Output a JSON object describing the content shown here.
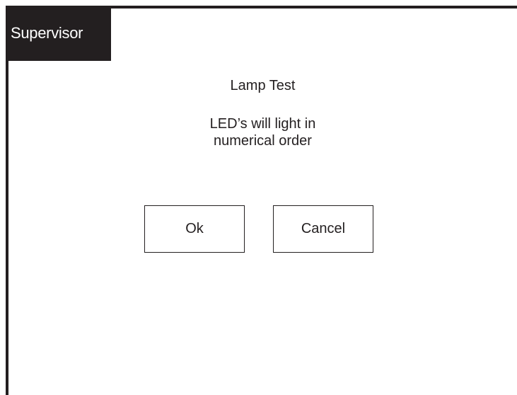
{
  "header": {
    "tab_label": "Supervisor"
  },
  "dialog": {
    "title": "Lamp Test",
    "message_line1": "LED’s will light in",
    "message_line2": "numerical order",
    "ok_label": "Ok",
    "cancel_label": "Cancel"
  },
  "colors": {
    "frame": "#231f20",
    "background": "#ffffff",
    "tab_text": "#ffffff"
  }
}
